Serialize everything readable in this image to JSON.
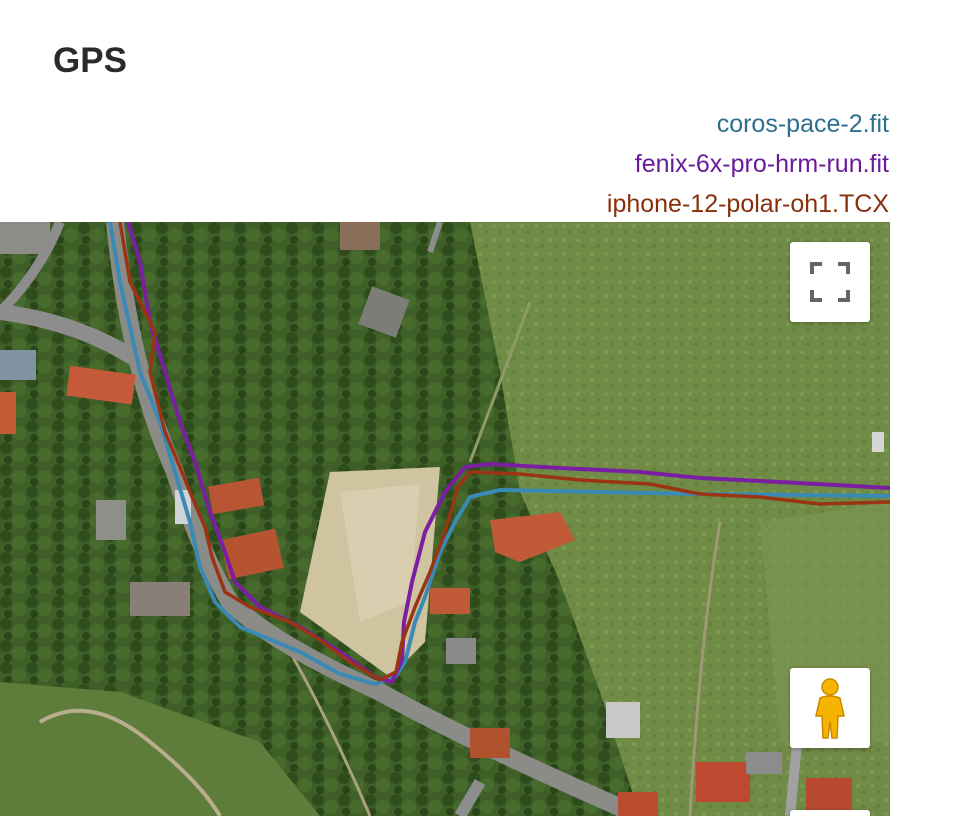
{
  "section": {
    "title": "GPS"
  },
  "legend": [
    {
      "label": "coros-pace-2.fit",
      "color": "#2e6e8e"
    },
    {
      "label": "fenix-6x-pro-hrm-run.fit",
      "color": "#6a1b9a"
    },
    {
      "label": "iphone-12-polar-oh1.TCX",
      "color": "#8a2f0b"
    }
  ],
  "map": {
    "view": "satellite",
    "controls": {
      "fullscreen_icon": "fullscreen-icon",
      "street_view_icon": "pegman-icon"
    }
  }
}
